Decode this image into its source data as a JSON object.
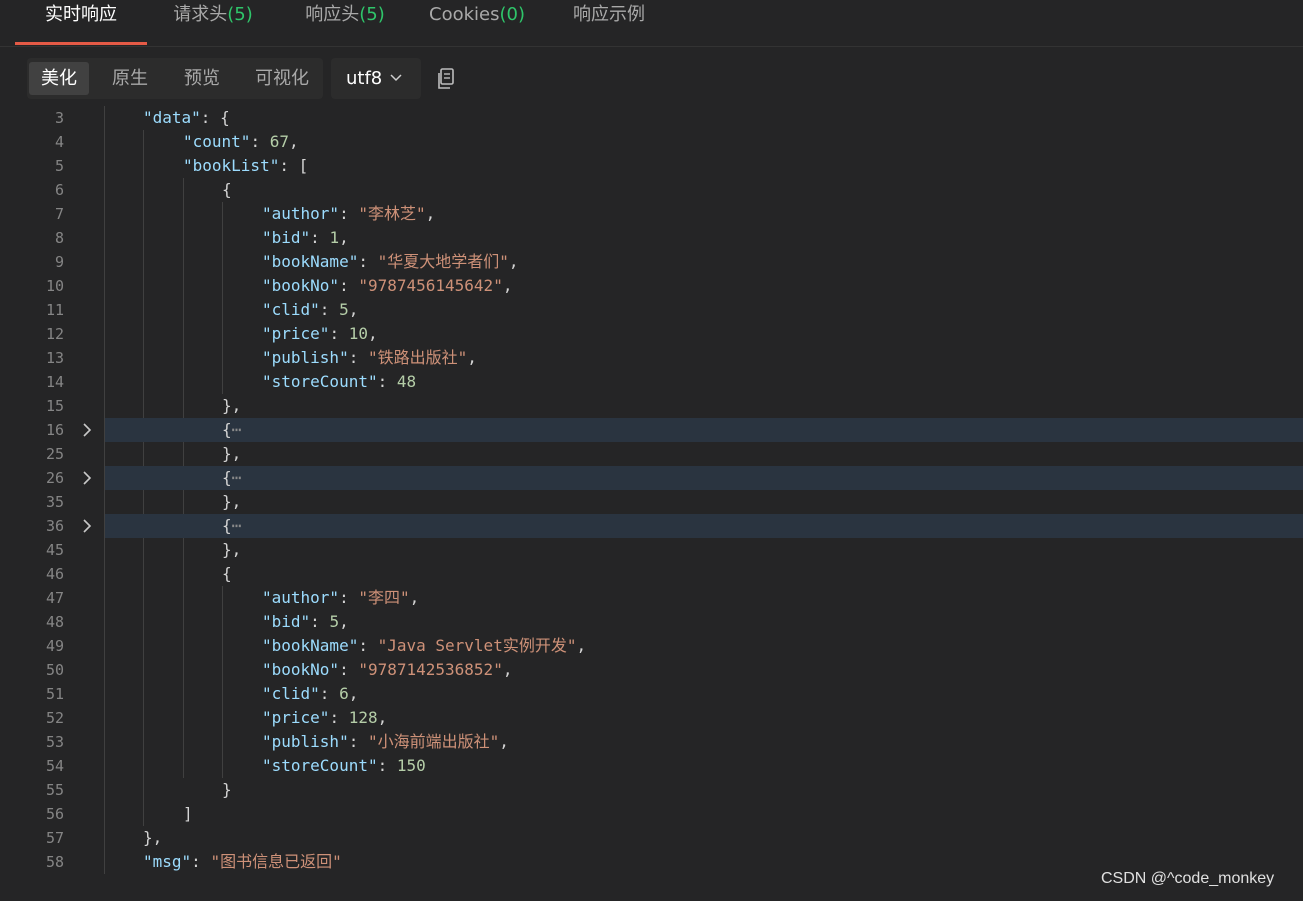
{
  "tabs": [
    {
      "label": "实时响应",
      "count": ""
    },
    {
      "label": "请求头",
      "count": "(5)"
    },
    {
      "label": "响应头",
      "count": "(5)"
    },
    {
      "label": "Cookies",
      "count": "(0)"
    },
    {
      "label": "响应示例",
      "count": ""
    }
  ],
  "view_modes": [
    "美化",
    "原生",
    "预览",
    "可视化"
  ],
  "encoding": "utf8",
  "code_lines": [
    {
      "num": "3",
      "indent": 1,
      "tokens": [
        [
          "k",
          "\"data\""
        ],
        [
          "p",
          ": {"
        ]
      ]
    },
    {
      "num": "4",
      "indent": 2,
      "tokens": [
        [
          "k",
          "\"count\""
        ],
        [
          "p",
          ": "
        ],
        [
          "n",
          "67"
        ],
        [
          "p",
          ","
        ]
      ]
    },
    {
      "num": "5",
      "indent": 2,
      "tokens": [
        [
          "k",
          "\"bookList\""
        ],
        [
          "p",
          ": ["
        ]
      ]
    },
    {
      "num": "6",
      "indent": 3,
      "tokens": [
        [
          "p",
          "{"
        ]
      ]
    },
    {
      "num": "7",
      "indent": 4,
      "tokens": [
        [
          "k",
          "\"author\""
        ],
        [
          "p",
          ": "
        ],
        [
          "s",
          "\"李林芝\""
        ],
        [
          "p",
          ","
        ]
      ]
    },
    {
      "num": "8",
      "indent": 4,
      "tokens": [
        [
          "k",
          "\"bid\""
        ],
        [
          "p",
          ": "
        ],
        [
          "n",
          "1"
        ],
        [
          "p",
          ","
        ]
      ]
    },
    {
      "num": "9",
      "indent": 4,
      "tokens": [
        [
          "k",
          "\"bookName\""
        ],
        [
          "p",
          ": "
        ],
        [
          "s",
          "\"华夏大地学者们\""
        ],
        [
          "p",
          ","
        ]
      ]
    },
    {
      "num": "10",
      "indent": 4,
      "tokens": [
        [
          "k",
          "\"bookNo\""
        ],
        [
          "p",
          ": "
        ],
        [
          "s",
          "\"9787456145642\""
        ],
        [
          "p",
          ","
        ]
      ]
    },
    {
      "num": "11",
      "indent": 4,
      "tokens": [
        [
          "k",
          "\"clid\""
        ],
        [
          "p",
          ": "
        ],
        [
          "n",
          "5"
        ],
        [
          "p",
          ","
        ]
      ]
    },
    {
      "num": "12",
      "indent": 4,
      "tokens": [
        [
          "k",
          "\"price\""
        ],
        [
          "p",
          ": "
        ],
        [
          "n",
          "10"
        ],
        [
          "p",
          ","
        ]
      ]
    },
    {
      "num": "13",
      "indent": 4,
      "tokens": [
        [
          "k",
          "\"publish\""
        ],
        [
          "p",
          ": "
        ],
        [
          "s",
          "\"铁路出版社\""
        ],
        [
          "p",
          ","
        ]
      ]
    },
    {
      "num": "14",
      "indent": 4,
      "tokens": [
        [
          "k",
          "\"storeCount\""
        ],
        [
          "p",
          ": "
        ],
        [
          "n",
          "48"
        ]
      ]
    },
    {
      "num": "15",
      "indent": 3,
      "tokens": [
        [
          "p",
          "},"
        ]
      ]
    },
    {
      "num": "16",
      "indent": 3,
      "fold": true,
      "tokens": [
        [
          "p",
          "{"
        ],
        [
          "e",
          "⋯"
        ]
      ]
    },
    {
      "num": "25",
      "indent": 3,
      "tokens": [
        [
          "p",
          "},"
        ]
      ]
    },
    {
      "num": "26",
      "indent": 3,
      "fold": true,
      "tokens": [
        [
          "p",
          "{"
        ],
        [
          "e",
          "⋯"
        ]
      ]
    },
    {
      "num": "35",
      "indent": 3,
      "tokens": [
        [
          "p",
          "},"
        ]
      ]
    },
    {
      "num": "36",
      "indent": 3,
      "fold": true,
      "tokens": [
        [
          "p",
          "{"
        ],
        [
          "e",
          "⋯"
        ]
      ]
    },
    {
      "num": "45",
      "indent": 3,
      "tokens": [
        [
          "p",
          "},"
        ]
      ]
    },
    {
      "num": "46",
      "indent": 3,
      "tokens": [
        [
          "p",
          "{"
        ]
      ]
    },
    {
      "num": "47",
      "indent": 4,
      "tokens": [
        [
          "k",
          "\"author\""
        ],
        [
          "p",
          ": "
        ],
        [
          "s",
          "\"李四\""
        ],
        [
          "p",
          ","
        ]
      ]
    },
    {
      "num": "48",
      "indent": 4,
      "tokens": [
        [
          "k",
          "\"bid\""
        ],
        [
          "p",
          ": "
        ],
        [
          "n",
          "5"
        ],
        [
          "p",
          ","
        ]
      ]
    },
    {
      "num": "49",
      "indent": 4,
      "tokens": [
        [
          "k",
          "\"bookName\""
        ],
        [
          "p",
          ": "
        ],
        [
          "s",
          "\"Java Servlet实例开发\""
        ],
        [
          "p",
          ","
        ]
      ]
    },
    {
      "num": "50",
      "indent": 4,
      "tokens": [
        [
          "k",
          "\"bookNo\""
        ],
        [
          "p",
          ": "
        ],
        [
          "s",
          "\"9787142536852\""
        ],
        [
          "p",
          ","
        ]
      ]
    },
    {
      "num": "51",
      "indent": 4,
      "tokens": [
        [
          "k",
          "\"clid\""
        ],
        [
          "p",
          ": "
        ],
        [
          "n",
          "6"
        ],
        [
          "p",
          ","
        ]
      ]
    },
    {
      "num": "52",
      "indent": 4,
      "tokens": [
        [
          "k",
          "\"price\""
        ],
        [
          "p",
          ": "
        ],
        [
          "n",
          "128"
        ],
        [
          "p",
          ","
        ]
      ]
    },
    {
      "num": "53",
      "indent": 4,
      "tokens": [
        [
          "k",
          "\"publish\""
        ],
        [
          "p",
          ": "
        ],
        [
          "s",
          "\"小海前端出版社\""
        ],
        [
          "p",
          ","
        ]
      ]
    },
    {
      "num": "54",
      "indent": 4,
      "tokens": [
        [
          "k",
          "\"storeCount\""
        ],
        [
          "p",
          ": "
        ],
        [
          "n",
          "150"
        ]
      ]
    },
    {
      "num": "55",
      "indent": 3,
      "tokens": [
        [
          "p",
          "}"
        ]
      ]
    },
    {
      "num": "56",
      "indent": 2,
      "tokens": [
        [
          "p",
          "]"
        ]
      ]
    },
    {
      "num": "57",
      "indent": 1,
      "tokens": [
        [
          "p",
          "},"
        ]
      ]
    },
    {
      "num": "58",
      "indent": 1,
      "tokens": [
        [
          "k",
          "\"msg\""
        ],
        [
          "p",
          ": "
        ],
        [
          "s",
          "\"图书信息已返回\""
        ]
      ]
    }
  ],
  "watermark": "CSDN @^code_monkey",
  "colors": {
    "accent": "#e45a46",
    "count": "#2fc56a",
    "key": "#9cdcfe",
    "string": "#ce9178",
    "number": "#b5cea8"
  }
}
